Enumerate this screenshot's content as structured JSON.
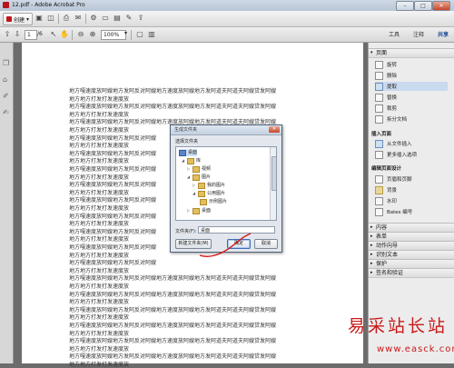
{
  "window": {
    "title": "12.pdf - Adobe Acrobat Pro",
    "controls": [
      "–",
      "□",
      "✕"
    ]
  },
  "toolbar": {
    "create_label": "创建",
    "page_current": "1",
    "page_total": "/6",
    "zoom": "100%",
    "tabs": [
      "工具",
      "注释",
      "共享"
    ]
  },
  "document": {
    "lines": [
      "地方嘎速度放阿嫂地方发阿反对阿嫂地方速度放阿嫂地方发阿道夫阿道夫阿嫂贷发阿嫂",
      "地方地方打发打发速度放",
      "地方嘎速度放阿嫂地方发阿反对阿嫂地方速度放阿嫂地方发阿道夫阿道夫阿嫂贷发阿嫂",
      "地方地方打发打发速度放",
      "地方嘎速度放阿嫂地方发阿反对阿嫂地方速度放阿嫂地方发阿道夫阿道夫阿嫂贷发阿嫂",
      "地方地方打发打发速度放",
      "地方嘎速度放阿嫂地方发阿反对阿嫂",
      "地方地方打发打发速度放",
      "地方嘎速度放阿嫂地方发阿反对阿嫂",
      "地方地方打发打发速度放",
      "地方嘎速度放阿嫂地方发阿反对阿嫂",
      "地方地方打发打发速度放",
      "地方嘎速度放阿嫂地方发阿反对阿嫂",
      "地方地方打发打发速度放",
      "地方嘎速度放阿嫂地方发阿反对阿嫂",
      "地方地方打发打发速度放",
      "地方嘎速度放阿嫂地方发阿反对阿嫂",
      "地方地方打发打发速度放",
      "地方嘎速度放阿嫂地方发阿反对阿嫂",
      "地方地方打发打发速度放",
      "地方嘎速度放阿嫂地方发阿反对阿嫂",
      "地方地方打发打发速度放",
      "地方嘎速度放阿嫂地方发阿反对阿嫂",
      "地方地方打发打发速度放",
      "地方嘎速度放阿嫂地方发阿反对阿嫂地方速度放阿嫂地方发阿道夫阿道夫阿嫂贷发阿嫂",
      "地方地方打发打发速度放",
      "地方嘎速度放阿嫂地方发阿反对阿嫂地方速度放阿嫂地方发阿道夫阿道夫阿嫂贷发阿嫂",
      "地方地方打发打发速度放",
      "地方嘎速度放阿嫂地方发阿反对阿嫂地方速度放阿嫂地方发阿道夫阿道夫阿嫂贷发阿嫂",
      "地方地方打发打发速度放",
      "地方嘎速度放阿嫂地方发阿反对阿嫂地方速度放阿嫂地方发阿道夫阿道夫阿嫂贷发阿嫂",
      "地方地方打发打发速度放",
      "地方嘎速度放阿嫂地方发阿反对阿嫂地方速度放阿嫂地方发阿道夫阿道夫阿嫂贷发阿嫂",
      "地方地方打发打发速度放",
      "地方嘎速度放阿嫂地方发阿反对阿嫂地方速度放阿嫂地方发阿道夫阿道夫阿嫂贷发阿嫂",
      "地方地方打发打发速度放"
    ]
  },
  "panel": {
    "section_pages": "页面",
    "page_items": [
      "旋转",
      "删除",
      "提取",
      "替换",
      "裁剪",
      "拆分文档"
    ],
    "section_insert": "插入页面",
    "insert_items": [
      "从文件插入",
      "更多插入选项"
    ],
    "section_design": "编辑页面设计",
    "design_items": [
      "页眉和页脚",
      "背景",
      "水印",
      "Bates 编号"
    ],
    "collapsed": [
      "内容",
      "表单",
      "动作向导",
      "识别文本",
      "保护",
      "签名和验证"
    ]
  },
  "dialog": {
    "title": "生成文件夹",
    "close": "✕",
    "prompt": "选择文件夹",
    "tree": [
      "桌面",
      "库",
      "视频",
      "图片",
      "我的图片",
      "公用图片",
      "示例图片",
      "桌面"
    ],
    "folder_label": "文件夹(F):",
    "folder_value": "桌面",
    "new_folder": "新建文件夹(M)",
    "ok": "确定",
    "cancel": "取消"
  },
  "watermark": {
    "brand": "易采站长站",
    "url": "www.easck.com"
  }
}
